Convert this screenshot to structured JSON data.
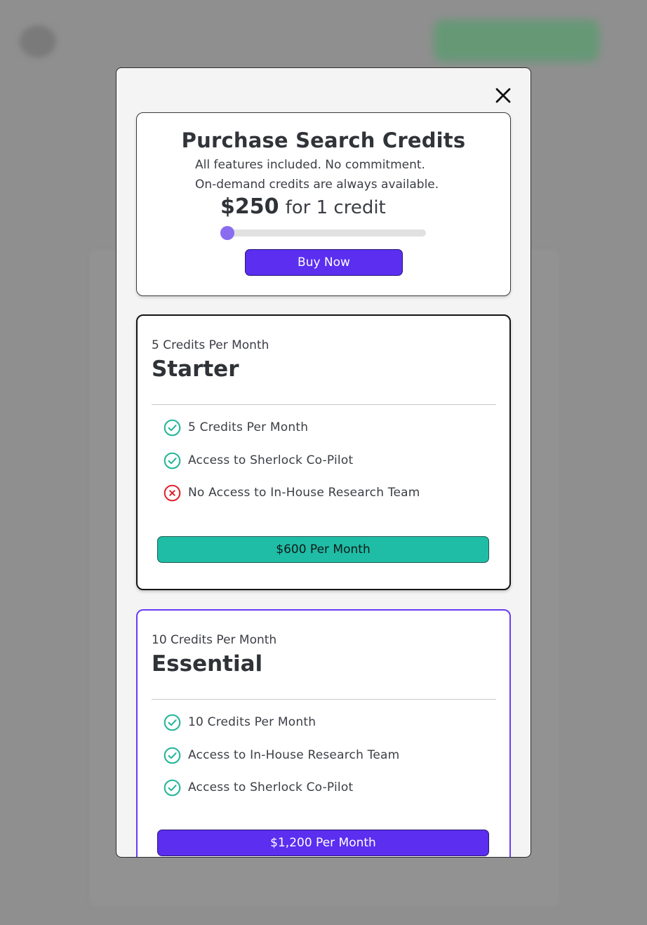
{
  "modal": {
    "close_icon": "close-icon"
  },
  "credits": {
    "title": "Purchase Search Credits",
    "subtitle_line1": "All features included. No commitment.",
    "subtitle_line2": "On-demand credits are always available.",
    "price": "$250",
    "price_suffix": "for 1 credit",
    "slider_value": 1,
    "buy_label": "Buy Now"
  },
  "plans": [
    {
      "subtitle": "5 Credits Per Month",
      "name": "Starter",
      "features": [
        {
          "text": "5 Credits Per Month",
          "included": true,
          "icon": "check-circle-icon"
        },
        {
          "text": "Access to Sherlock Co-Pilot",
          "included": true,
          "icon": "check-circle-icon"
        },
        {
          "text": "No Access to In-House Research Team",
          "included": false,
          "icon": "x-circle-icon"
        }
      ],
      "button_label": "$600 Per Month",
      "accent": "#1fbda6"
    },
    {
      "subtitle": "10 Credits Per Month",
      "name": "Essential",
      "features": [
        {
          "text": "10 Credits Per Month",
          "included": true,
          "icon": "check-circle-icon"
        },
        {
          "text": "Access to In-House Research Team",
          "included": true,
          "icon": "check-circle-icon"
        },
        {
          "text": "Access to Sherlock Co-Pilot",
          "included": true,
          "icon": "check-circle-icon"
        }
      ],
      "button_label": "$1,200 Per Month",
      "accent": "#5b2ef0"
    }
  ],
  "colors": {
    "brand_purple": "#5b2ef0",
    "teal": "#1fbda6",
    "check_green": "#1fb596",
    "error_red": "#e0202a",
    "overlay": "#8e8e8e"
  }
}
